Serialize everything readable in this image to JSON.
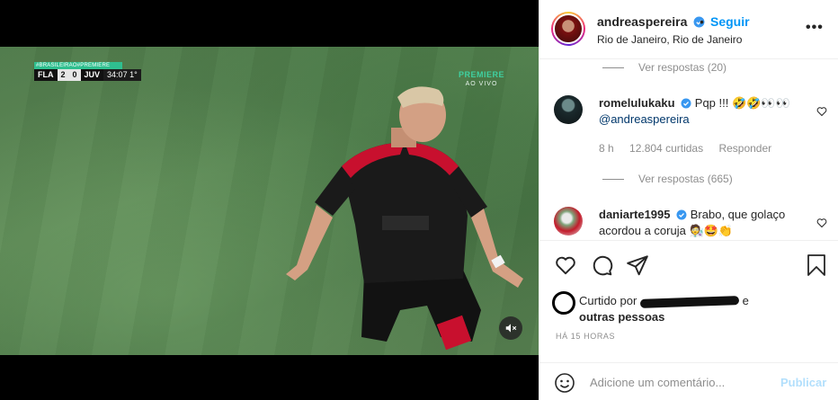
{
  "video": {
    "scoreboard": {
      "banner": "#BRASILEIRAO#PREMIERE",
      "home_team": "FLA",
      "home_score": "2",
      "away_score": "0",
      "away_team": "JUV",
      "clock": "34:07 1°"
    },
    "broadcast": {
      "channel": "PREMIERE",
      "status": "AO VIVO"
    },
    "mute_icon": "speaker-muted-icon",
    "colors": {
      "field": "#547f4e",
      "jersey_black": "#1a1a1a",
      "jersey_red": "#c8102e"
    }
  },
  "post": {
    "header": {
      "username": "andreaspereira",
      "separator": "•",
      "follow_label": "Seguir",
      "location": "Rio de Janeiro, Rio de Janeiro",
      "more_icon": "more-options-icon"
    },
    "comments_section": {
      "view_replies_1": "Ver respostas (20)",
      "comment_1": {
        "username": "romelulukaku",
        "text": "Pqp !!! 🤣🤣👀👀",
        "mention": "@andreaspereira",
        "time": "8 h",
        "likes": "12.804 curtidas",
        "reply_label": "Responder"
      },
      "view_replies_2": "Ver respostas (665)",
      "comment_2": {
        "username": "daniarte1995",
        "text": "Brabo, que golaço acordou a coruja 🧑‍🔬🤩👏"
      }
    },
    "actions": {
      "like_icon": "heart-icon",
      "comment_icon": "comment-icon",
      "share_icon": "share-icon",
      "save_icon": "bookmark-icon"
    },
    "likes": {
      "prefix": "Curtido por",
      "suffix": "e",
      "others": "outras pessoas"
    },
    "time_ago": "HÁ 15 HORAS",
    "add_comment": {
      "placeholder": "Adicione um comentário...",
      "publish_label": "Publicar"
    },
    "colors": {
      "accent": "#0095f6",
      "publish_disabled": "#b2dffc",
      "text": "#262626",
      "muted": "#8e8e8e"
    }
  }
}
